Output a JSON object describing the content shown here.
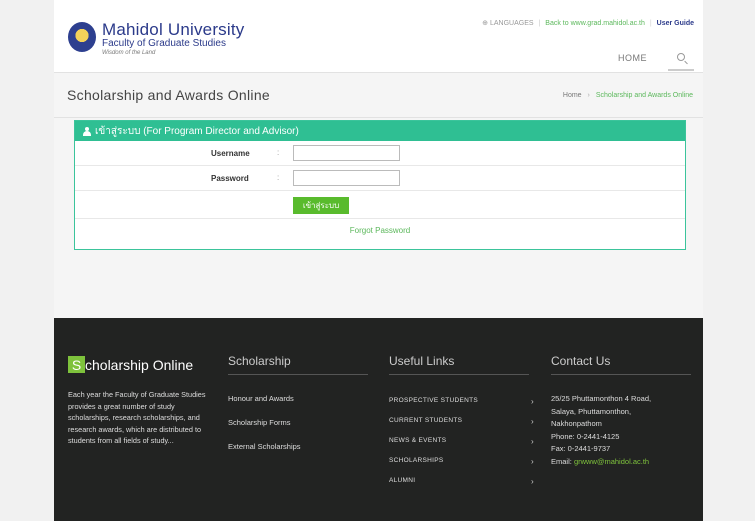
{
  "header": {
    "university": "Mahidol University",
    "faculty": "Faculty of Graduate Studies",
    "motto": "Wisdom of the Land",
    "top_links": {
      "languages": "LANGUAGES",
      "back": "Back to www.grad.mahidol.ac.th",
      "guide": "User Guide"
    },
    "nav_home": "HOME"
  },
  "title_bar": {
    "title": "Scholarship and Awards Online",
    "breadcrumb_home": "Home",
    "breadcrumb_current": "Scholarship and Awards Online"
  },
  "login": {
    "heading": "เข้าสู่ระบบ (For Program Director and Advisor)",
    "username_label": "Username",
    "password_label": "Password",
    "colon": ":",
    "username_value": "",
    "password_value": "",
    "button_label": "เข้าสู่ระบบ",
    "forgot": "Forgot Password"
  },
  "footer": {
    "brand_initial": "S",
    "brand_rest": "cholarship Online",
    "description": "Each year the Faculty of Graduate Studies provides a great number of study scholarships, research scholarships, and research awards, which are distributed to students from all fields of study...",
    "scholarship": {
      "heading": "Scholarship",
      "items": [
        "Honour and Awards",
        "Scholarship Forms",
        "External Scholarships"
      ]
    },
    "useful_links": {
      "heading": "Useful Links",
      "items": [
        "PROSPECTIVE STUDENTS",
        "CURRENT STUDENTS",
        "NEWS & EVENTS",
        "SCHOLARSHIPS",
        "ALUMNI"
      ],
      "chevron": "›"
    },
    "contact": {
      "heading": "Contact Us",
      "address1": "25/25 Phuttamonthon 4 Road,",
      "address2": "Salaya, Phuttamonthon,",
      "address3": "Nakhonpathom",
      "phone": "Phone: 0-2441-4125",
      "fax": "Fax: 0-2441-9737",
      "email_label": "Email:",
      "email": "grwww@mahidol.ac.th"
    }
  },
  "colors": {
    "accent_green": "#2fbf93",
    "button_green": "#59bb2d",
    "footer_bg": "#222322",
    "brand_blue": "#2b3a8a"
  }
}
